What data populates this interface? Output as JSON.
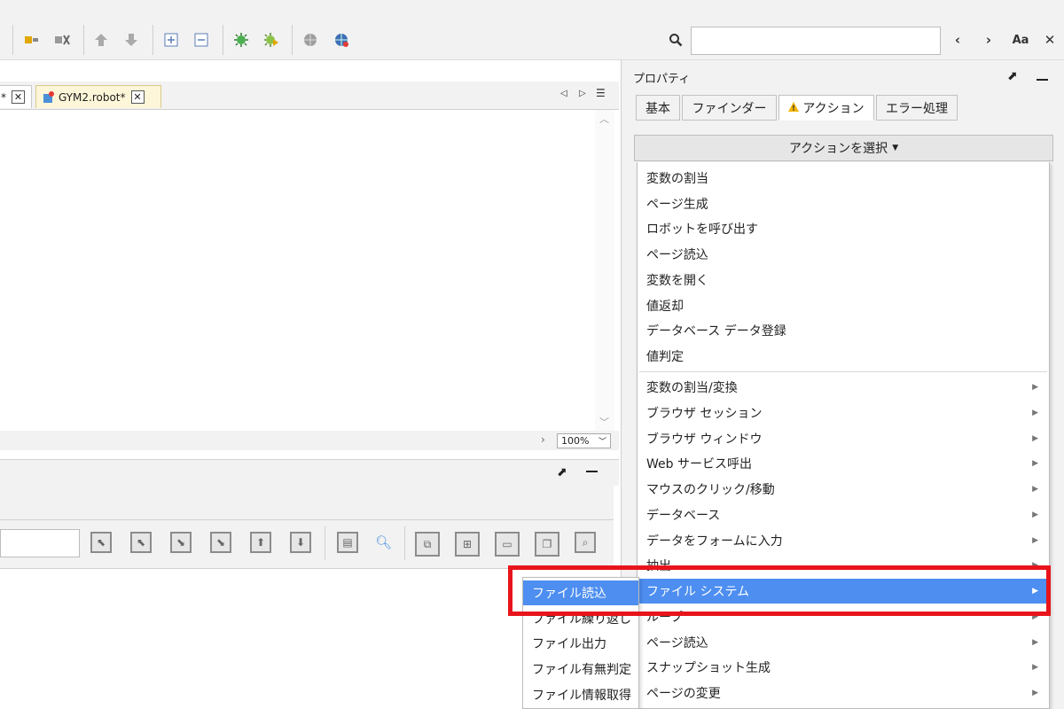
{
  "toolbar": {
    "icons": [
      "connect-icon",
      "disconnect-icon",
      "upload-icon",
      "download-icon",
      "expand-icon",
      "collapse-icon",
      "debug-icon",
      "debug-step-icon",
      "globe-icon",
      "globe-refresh-icon"
    ],
    "search_placeholder": "",
    "prev_label": "‹",
    "next_label": "›",
    "match_case_label": "Aa",
    "close_label": "✕"
  },
  "editor": {
    "tabs": [
      {
        "label": "*"
      },
      {
        "label": "GYM2.robot*"
      }
    ],
    "zoom": "100%"
  },
  "properties": {
    "title": "プロパティ",
    "tabs": [
      "基本",
      "ファインダー",
      "アクション",
      "エラー処理"
    ],
    "active_tab": "アクション",
    "select_label": "アクションを選択"
  },
  "action_menu": {
    "group1": [
      "変数の割当",
      "ページ生成",
      "ロボットを呼び出す",
      "ページ読込",
      "変数を開く",
      "値返却",
      "データベース データ登録",
      "値判定"
    ],
    "group2": [
      "変数の割当/変換",
      "ブラウザ セッション",
      "ブラウザ ウィンドウ",
      "Web サービス呼出",
      "マウスのクリック/移動",
      "データベース",
      "データをフォームに入力",
      "抽出",
      "ファイル システム",
      "ループ",
      "ページ読込",
      "スナップショット生成",
      "ページの変更"
    ],
    "highlighted": "ファイル システム"
  },
  "sub_menu": {
    "items": [
      "ファイル読込",
      "ファイル繰り返し",
      "ファイル出力",
      "ファイル有無判定",
      "ファイル情報取得"
    ],
    "highlighted": "ファイル読込"
  },
  "colors": {
    "highlight": "#4d8ef0",
    "annotation_box": "#e8141c"
  }
}
